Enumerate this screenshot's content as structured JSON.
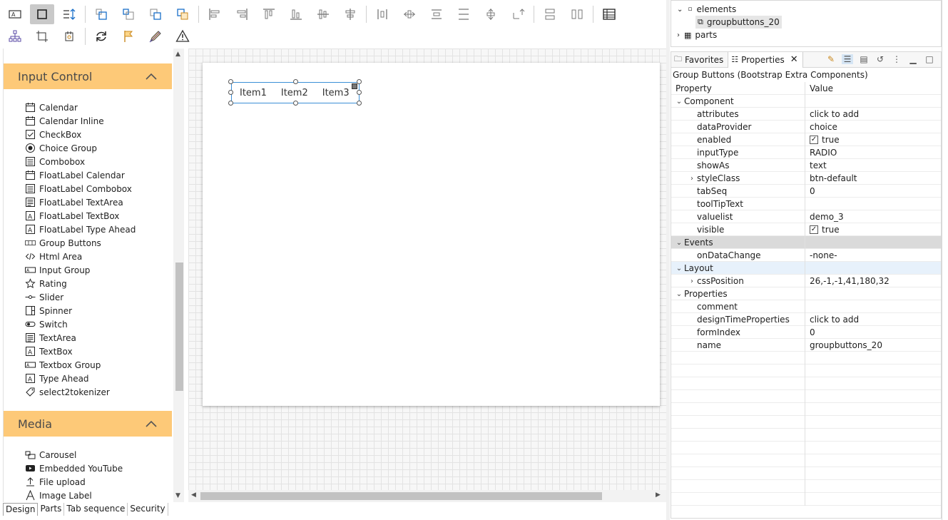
{
  "toolbar": {
    "row1": [
      "text-field-tool-icon",
      "select-rect-tool-icon",
      "tab-order-icon",
      "bring-forward-icon",
      "send-backward-icon",
      "bring-to-front-icon",
      "send-to-back-icon",
      "align-left-icon",
      "align-right-icon",
      "align-top-icon",
      "align-bottom-icon",
      "align-center-h-icon",
      "align-center-v-icon",
      "distribute-h-icon",
      "distribute-h-center-icon",
      "distribute-v-icon",
      "distribute-v-spacing-icon",
      "distribute-v-center-icon",
      "resize-icon",
      "same-width-icon",
      "same-height-icon",
      "table-icon"
    ],
    "row2": [
      "hierarchy-icon",
      "anchor-icon",
      "group-icon",
      "refresh-icon",
      "flag-icon",
      "pencil-ruler-icon",
      "warning-icon"
    ]
  },
  "palette": {
    "category1": "Input Control",
    "items": [
      "Calendar",
      "Calendar Inline",
      "CheckBox",
      "Choice Group",
      "Combobox",
      "FloatLabel Calendar",
      "FloatLabel Combobox",
      "FloatLabel TextArea",
      "FloatLabel TextBox",
      "FloatLabel Type Ahead",
      "Group Buttons",
      "Html Area",
      "Input Group",
      "Rating",
      "Slider",
      "Spinner",
      "Switch",
      "TextArea",
      "TextBox",
      "Textbox Group",
      "Type Ahead",
      "select2tokenizer"
    ],
    "category2": "Media",
    "media_items": [
      "Carousel",
      "Embedded YouTube",
      "File upload",
      "Image Label"
    ]
  },
  "canvas": {
    "group_buttons": [
      "Item1",
      "Item2",
      "Item3"
    ]
  },
  "bottom_tabs": [
    "Design",
    "Parts",
    "Tab sequence",
    "Security"
  ],
  "outline": {
    "elements": "elements",
    "selected": "groupbuttons_20",
    "parts": "parts"
  },
  "properties": {
    "tabs": {
      "favorites": "Favorites",
      "properties": "Properties"
    },
    "title": "Group Buttons (Bootstrap Extra Components)",
    "col_property": "Property",
    "col_value": "Value",
    "sections": {
      "component": "Component",
      "events": "Events",
      "layout": "Layout",
      "properties": "Properties"
    },
    "component_rows": [
      {
        "name": "attributes",
        "value": "click to add"
      },
      {
        "name": "dataProvider",
        "value": "choice"
      },
      {
        "name": "enabled",
        "value": "true"
      },
      {
        "name": "inputType",
        "value": "RADIO"
      },
      {
        "name": "showAs",
        "value": "text"
      },
      {
        "name": "styleClass",
        "value": "btn-default"
      },
      {
        "name": "tabSeq",
        "value": "0"
      },
      {
        "name": "toolTipText",
        "value": ""
      },
      {
        "name": "valuelist",
        "value": "demo_3"
      },
      {
        "name": "visible",
        "value": "true"
      }
    ],
    "events_rows": [
      {
        "name": "onDataChange",
        "value": "-none-"
      }
    ],
    "layout_rows": [
      {
        "name": "cssPosition",
        "value": "26,-1,-1,41,180,32"
      }
    ],
    "properties_rows": [
      {
        "name": "comment",
        "value": ""
      },
      {
        "name": "designTimeProperties",
        "value": "click to add"
      },
      {
        "name": "formIndex",
        "value": "0"
      },
      {
        "name": "name",
        "value": "groupbuttons_20"
      }
    ]
  },
  "colors": {
    "category_header": "#fdc978",
    "selection": "#3b8fd6",
    "events_row": "#dadada",
    "layout_row": "#e7f1fb"
  }
}
